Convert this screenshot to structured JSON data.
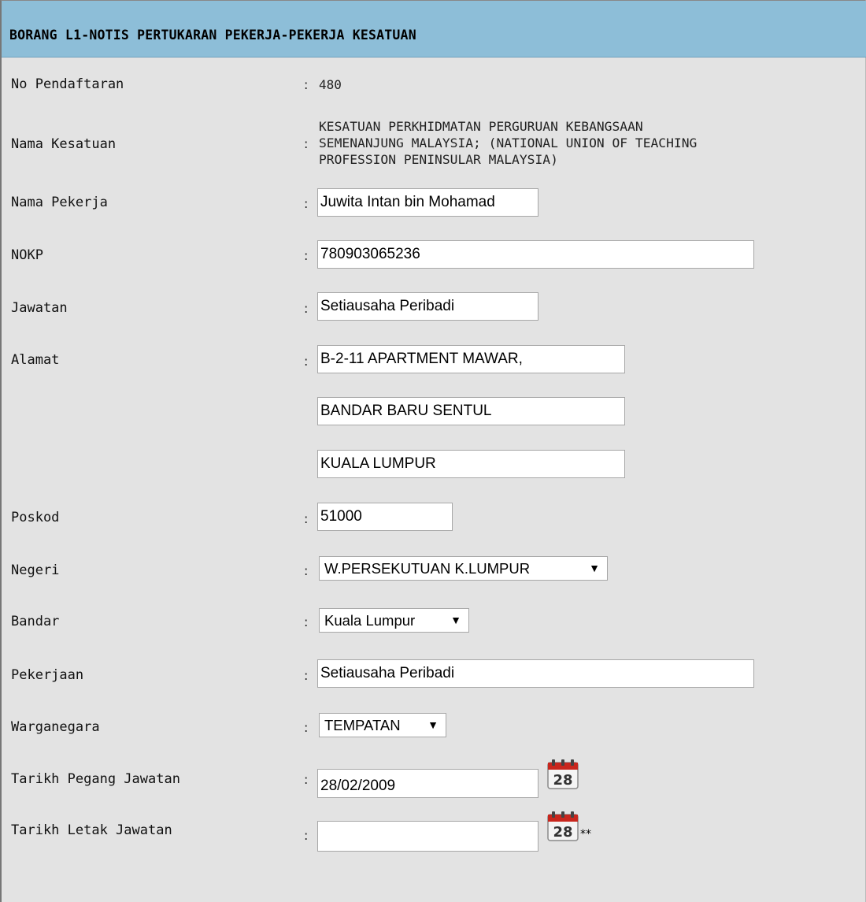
{
  "form": {
    "title": "BORANG L1-NOTIS PERTUKARAN PEKERJA-PEKERJA KESATUAN",
    "colon": ":",
    "fields": {
      "no_pendaftaran": {
        "label": "No Pendaftaran",
        "value": "480"
      },
      "nama_kesatuan": {
        "label": "Nama Kesatuan",
        "lines": [
          "KESATUAN PERKHIDMATAN PERGURUAN KEBANGSAAN",
          "SEMENANJUNG MALAYSIA; (NATIONAL UNION OF TEACHING",
          "PROFESSION PENINSULAR MALAYSIA)"
        ]
      },
      "nama_pekerja": {
        "label": "Nama Pekerja",
        "value": "Juwita Intan bin Mohamad"
      },
      "nokp": {
        "label": "NOKP",
        "value": "780903065236"
      },
      "jawatan": {
        "label": "Jawatan",
        "value": "Setiausaha Peribadi"
      },
      "alamat": {
        "label": "Alamat",
        "line1": "B-2-11 APARTMENT MAWAR,",
        "line2": "BANDAR BARU SENTUL",
        "line3": "KUALA LUMPUR"
      },
      "poskod": {
        "label": "Poskod",
        "value": "51000"
      },
      "negeri": {
        "label": "Negeri",
        "selected": "W.PERSEKUTUAN K.LUMPUR"
      },
      "bandar": {
        "label": "Bandar",
        "selected": "Kuala Lumpur"
      },
      "pekerjaan": {
        "label": "Pekerjaan",
        "value": "Setiausaha Peribadi"
      },
      "warganegara": {
        "label": "Warganegara",
        "selected": "TEMPATAN"
      },
      "tarikh_pegang": {
        "label": "Tarikh Pegang Jawatan",
        "value": "28/02/2009",
        "calendar_day": "28"
      },
      "tarikh_letak": {
        "label": "Tarikh Letak Jawatan",
        "value": "",
        "calendar_day": "28",
        "note": "**"
      }
    }
  },
  "icons": {
    "calendar": "calendar-icon",
    "dropdown": "triangle-down-icon"
  },
  "colors": {
    "header_bg": "#8dbed8",
    "panel_bg": "#e3e3e3",
    "calendar_red": "#c8261d"
  }
}
